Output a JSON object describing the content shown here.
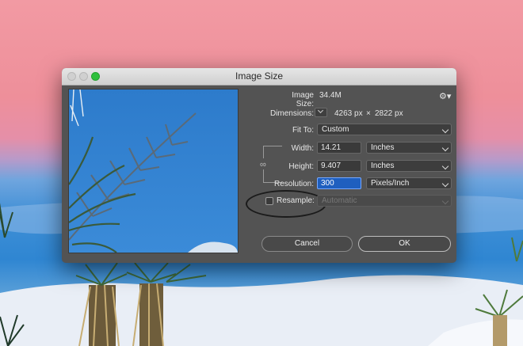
{
  "dialog": {
    "title": "Image Size",
    "image_size_label": "Image Size:",
    "image_size_value": "34.4M",
    "dimensions_label": "Dimensions:",
    "dimensions_width": "4263 px",
    "dimensions_times": "×",
    "dimensions_height": "2822 px",
    "fit_to_label": "Fit To:",
    "fit_to_value": "Custom",
    "width_label": "Width:",
    "width_value": "14.21",
    "width_unit": "Inches",
    "height_label": "Height:",
    "height_value": "9.407",
    "height_unit": "Inches",
    "resolution_label": "Resolution:",
    "resolution_value": "300",
    "resolution_unit": "Pixels/Inch",
    "resample_label": "Resample:",
    "resample_value": "Automatic",
    "cancel_label": "Cancel",
    "ok_label": "OK"
  },
  "icons": {
    "gear": "gear-icon",
    "link": "chain-link-icon",
    "dimensions_toggle": "chevron-down-icon"
  },
  "colors": {
    "dialog_bg": "#535353",
    "active_field": "#1f5fbf",
    "zoom_button": "#2fc03d"
  }
}
